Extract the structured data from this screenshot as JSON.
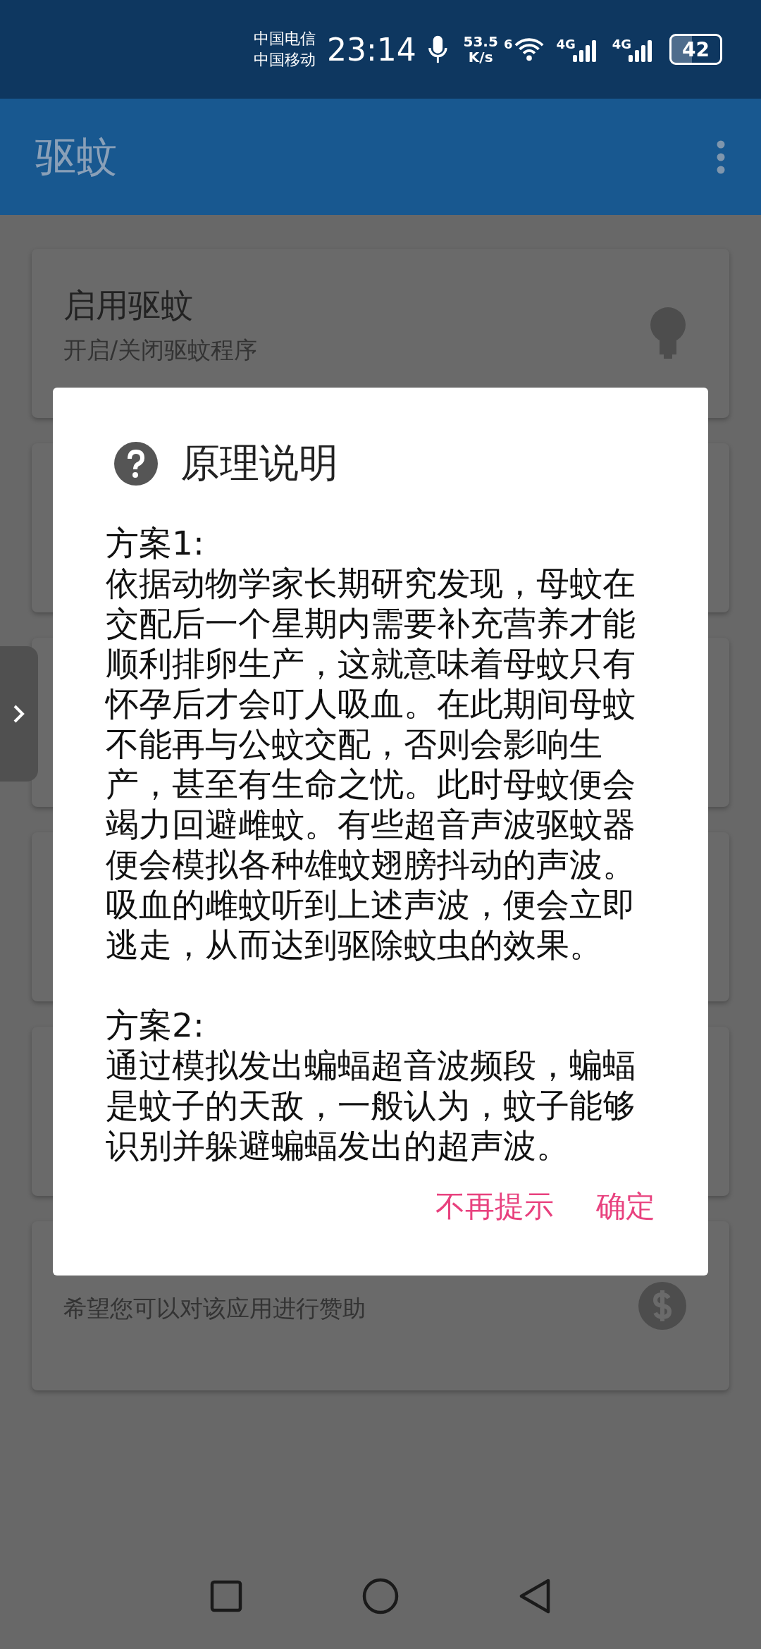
{
  "status_bar": {
    "carriers": [
      "中国电信",
      "中国移动"
    ],
    "time": "23:14",
    "speed_value": "53.5",
    "speed_unit": "K/s",
    "wifi_label": "6",
    "signals": [
      {
        "label": "4G"
      },
      {
        "label": "4G"
      }
    ],
    "battery": "42"
  },
  "app_bar": {
    "title": "驱蚊"
  },
  "cards": [
    {
      "title": "启用驱蚊",
      "subtitle": "开启/关闭驱蚊程序"
    },
    {
      "subtitle": "希望您可以对该应用进行赞助"
    }
  ],
  "dialog": {
    "title": "原理说明",
    "paragraphs": [
      {
        "heading": "方案1:",
        "body": "依据动物学家长期研究发现，母蚊在交配后一个星期内需要补充营养才能顺利排卵生产，这就意味着母蚊只有怀孕后才会叮人吸血。在此期间母蚊不能再与公蚊交配，否则会影响生产，甚至有生命之忧。此时母蚊便会竭力回避雌蚊。有些超音声波驱蚊器便会模拟各种雄蚊翅膀抖动的声波。吸血的雌蚊听到上述声波，便会立即逃走，从而达到驱除蚊虫的效果。"
      },
      {
        "heading": "方案2:",
        "body": "通过模拟发出蝙蝠超音波频段，蝙蝠是蚊子的天敌，一般认为，蚊子能够识别并躲避蝙蝠发出的超声波。"
      }
    ],
    "buttons": [
      "不再提示",
      "确定"
    ]
  }
}
